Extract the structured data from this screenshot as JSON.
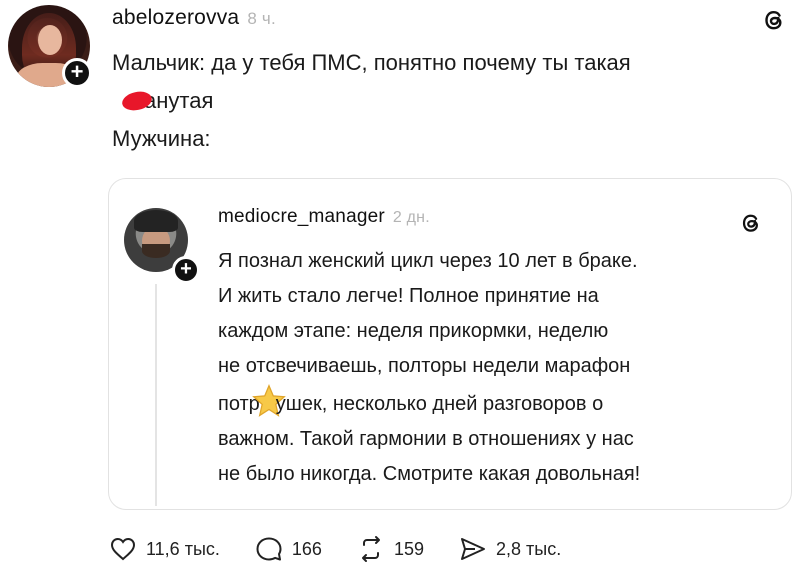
{
  "post": {
    "username": "abelozerovva",
    "time": "8 ч.",
    "text_lines": [
      "Мальчик: да у тебя ПМС, понятно почему ты такая",
      "анутая",
      "Мужчина:"
    ]
  },
  "quoted_post": {
    "username": "mediocre_manager",
    "time": "2 дн.",
    "text_lines": [
      "Я познал женский цикл через 10 лет в браке.",
      "И жить стало легче! Полное принятие на",
      "каждом этапе: неделя прикормки, неделю",
      "не отсвечиваешь, полторы недели марафон",
      "потр",
      "ушек, несколько дней разговоров о",
      "важном. Такой гармонии в отношениях у нас",
      "не было никогда. Смотрите какая довольная!"
    ]
  },
  "actions": {
    "likes": "11,6 тыс.",
    "comments": "166",
    "reposts": "159",
    "shares": "2,8 тыс."
  },
  "icons": {
    "like": "heart-icon",
    "comment": "comment-icon",
    "repost": "repost-icon",
    "share": "share-icon",
    "brand": "threads-icon"
  },
  "colors": {
    "text": "#1a1a1a",
    "muted": "#b4b4b4",
    "censor_mark": "#e8172a",
    "star": "#f7c948"
  }
}
